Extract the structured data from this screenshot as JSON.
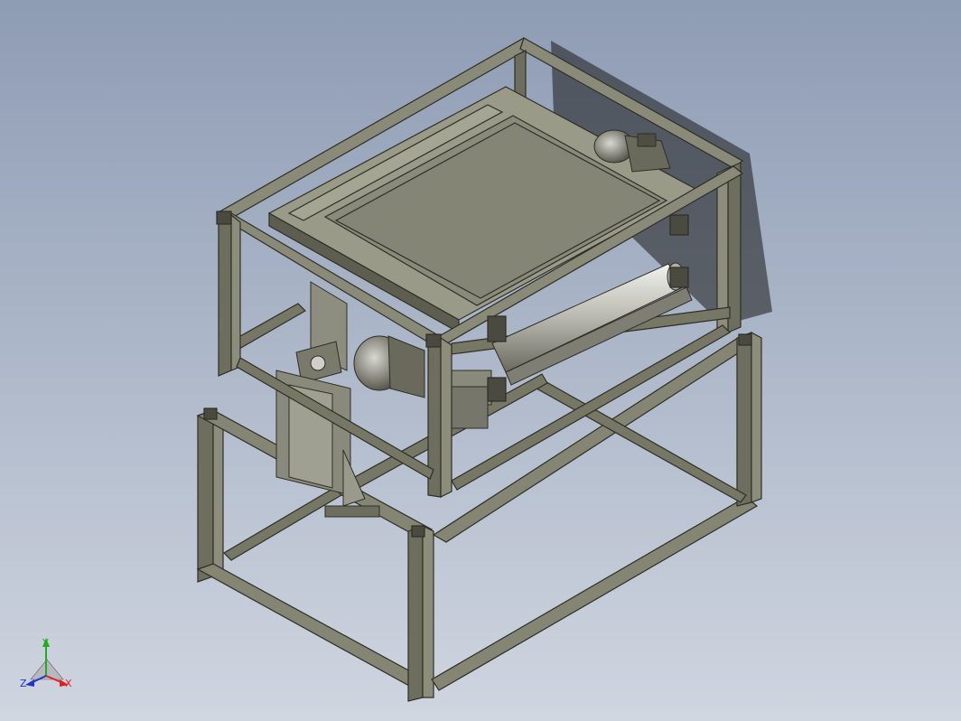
{
  "triad": {
    "y_label": "Y",
    "x_label": "X",
    "z_label": "Z",
    "colors": {
      "y": "#22aa22",
      "x": "#dd2222",
      "z": "#2233cc"
    }
  },
  "model": {
    "icon": "isometric-machine-frame-model",
    "colors": {
      "frame": "#6e6e5e",
      "frame_light": "#9a9a88",
      "frame_dark": "#3d3d33",
      "plate": "#8a8a7a",
      "cylinder": "#c8c8c0"
    }
  }
}
